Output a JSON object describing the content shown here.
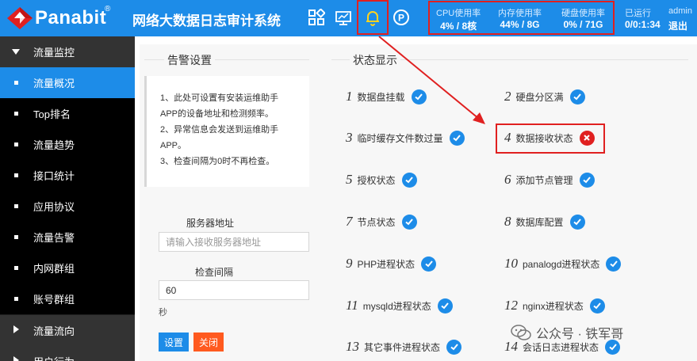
{
  "header": {
    "logo_text": "Panabit",
    "logo_reg": "®",
    "system_title": "网络大数据日志审计系统",
    "icons": [
      "apps-icon",
      "monitor-icon",
      "bell-icon",
      "p-circle-icon"
    ],
    "stats": [
      {
        "label": "CPU使用率",
        "value": "4% / 8核"
      },
      {
        "label": "内存使用率",
        "value": "44% / 8G"
      },
      {
        "label": "硬盘使用率",
        "value": "0% / 71G"
      }
    ],
    "uptime_label": "已运行",
    "uptime_value": "0/0:1:34",
    "user_name": "admin",
    "logout_label": "退出",
    "accent_color": "#1d8ce8",
    "highlight_color": "#e02020"
  },
  "sidebar": {
    "items": [
      {
        "label": "流量监控",
        "kind": "group-open"
      },
      {
        "label": "流量概况",
        "kind": "sub-active"
      },
      {
        "label": "Top排名",
        "kind": "sub"
      },
      {
        "label": "流量趋势",
        "kind": "sub"
      },
      {
        "label": "接口统计",
        "kind": "sub"
      },
      {
        "label": "应用协议",
        "kind": "sub"
      },
      {
        "label": "流量告警",
        "kind": "sub"
      },
      {
        "label": "内网群组",
        "kind": "sub"
      },
      {
        "label": "账号群组",
        "kind": "sub"
      },
      {
        "label": "流量流向",
        "kind": "group-closed"
      },
      {
        "label": "用户行为",
        "kind": "group-closed"
      }
    ]
  },
  "alarm": {
    "title": "告警设置",
    "notes": [
      "1、此处可设置有安装运维助手",
      "APP的设备地址和检测频率。",
      "2、异常信息会发送到运维助手",
      "APP。",
      "3、检查间隔为0时不再检查。"
    ],
    "server_label": "服务器地址",
    "server_placeholder": "请输入接收服务器地址",
    "interval_label": "检查间隔",
    "interval_value": "60",
    "interval_unit": "秒",
    "save_label": "设置",
    "close_label": "关闭"
  },
  "status": {
    "title": "状态显示",
    "items": [
      {
        "num": "1",
        "label": "数据盘挂载",
        "ok": true
      },
      {
        "num": "2",
        "label": "硬盘分区满",
        "ok": true
      },
      {
        "num": "3",
        "label": "临时缓存文件数过量",
        "ok": true
      },
      {
        "num": "4",
        "label": "数据接收状态",
        "ok": false
      },
      {
        "num": "5",
        "label": "授权状态",
        "ok": true
      },
      {
        "num": "6",
        "label": "添加节点管理",
        "ok": true
      },
      {
        "num": "7",
        "label": "节点状态",
        "ok": true
      },
      {
        "num": "8",
        "label": "数据库配置",
        "ok": true
      },
      {
        "num": "9",
        "label": "PHP进程状态",
        "ok": true
      },
      {
        "num": "10",
        "label": "panalogd进程状态",
        "ok": true
      },
      {
        "num": "11",
        "label": "mysqld进程状态",
        "ok": true
      },
      {
        "num": "12",
        "label": "nginx进程状态",
        "ok": true
      },
      {
        "num": "13",
        "label": "其它事件进程状态",
        "ok": true
      },
      {
        "num": "14",
        "label": "会话日志进程状态",
        "ok": true
      }
    ]
  },
  "watermark": "公众号 · 铁军哥"
}
